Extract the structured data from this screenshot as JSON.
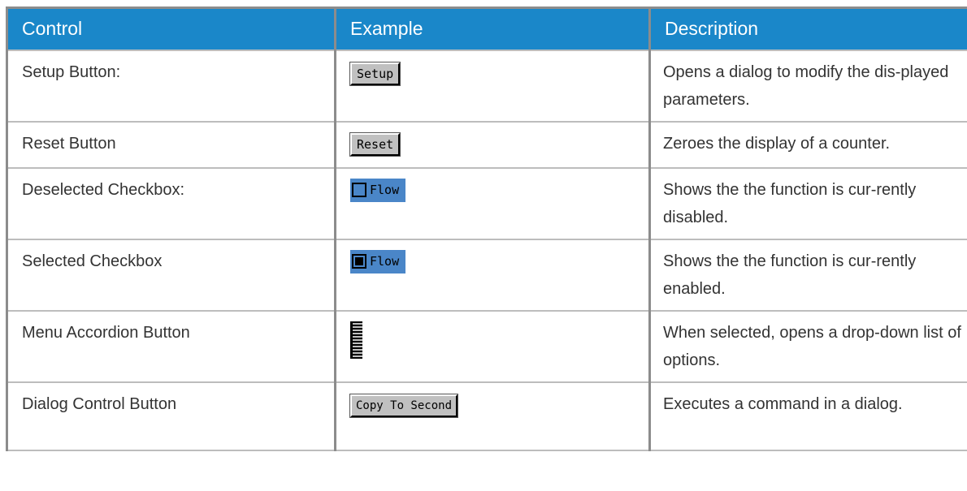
{
  "headers": {
    "control": "Control",
    "example": "Example",
    "description": "Description"
  },
  "rows": [
    {
      "control": "Setup Button:",
      "example": "Setup",
      "example_type": "button",
      "description": "Opens a dialog to modify the dis-played parameters."
    },
    {
      "control": "Reset Button",
      "example": "Reset",
      "example_type": "button",
      "description": "Zeroes the display of a counter."
    },
    {
      "control": "Deselected Checkbox:",
      "example": "Flow",
      "example_type": "checkbox-unchecked",
      "description": "Shows the the function is cur-rently disabled."
    },
    {
      "control": "Selected Checkbox",
      "example": "Flow",
      "example_type": "checkbox-checked",
      "description": "Shows the the function is cur-rently enabled."
    },
    {
      "control": "Menu Accordion Button",
      "example": "",
      "example_type": "accordion-icon",
      "description": "When selected, opens a drop-down list of options."
    },
    {
      "control": "Dialog Control Button",
      "example": "Copy To Second",
      "example_type": "button",
      "description": "Executes a command in a dialog."
    }
  ],
  "colors": {
    "header_bg": "#1a87c9",
    "header_text": "#ffffff",
    "checkbox_bg": "#4a86c8",
    "button_bg": "#c0c0c0"
  }
}
